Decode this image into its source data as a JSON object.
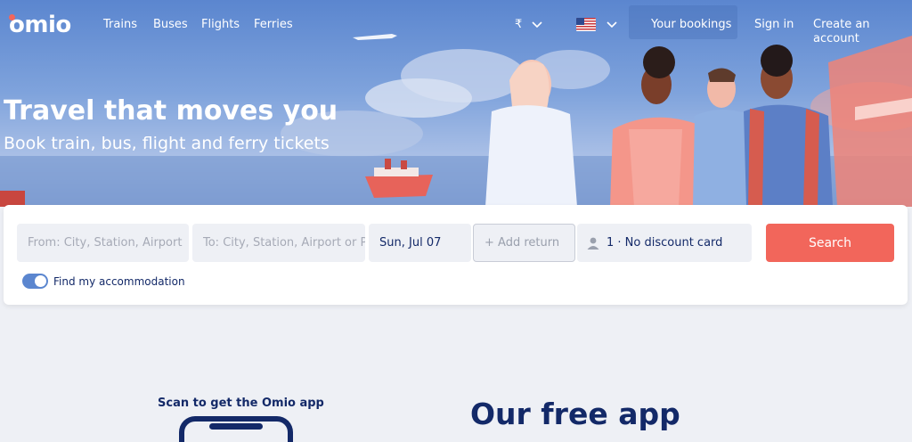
{
  "brand": {
    "name": "omio",
    "accent": "#f2665b",
    "navy": "#132968",
    "hero_blue": "#5b86cf"
  },
  "nav": {
    "links": [
      {
        "label": "Trains"
      },
      {
        "label": "Buses"
      },
      {
        "label": "Flights"
      },
      {
        "label": "Ferries"
      }
    ],
    "currency": "₹",
    "country_flag": "us-flag-icon",
    "your_bookings": "Your bookings",
    "sign_in": "Sign in",
    "create_account": "Create an account"
  },
  "hero": {
    "headline": "Travel that moves you",
    "subline": "Book train, bus, flight and ferry tickets"
  },
  "search": {
    "from_placeholder": "From: City, Station, Airport",
    "to_placeholder": "To: City, Station, Airport or Port",
    "date": "Sun, Jul 07",
    "add_return": "+ Add return",
    "passengers": "1 · No discount card",
    "search_label": "Search",
    "accommodation_label": "Find my accommodation",
    "accommodation_on": true
  },
  "app_promo": {
    "scan_label": "Scan to get the Omio app",
    "title": "Our free app"
  }
}
